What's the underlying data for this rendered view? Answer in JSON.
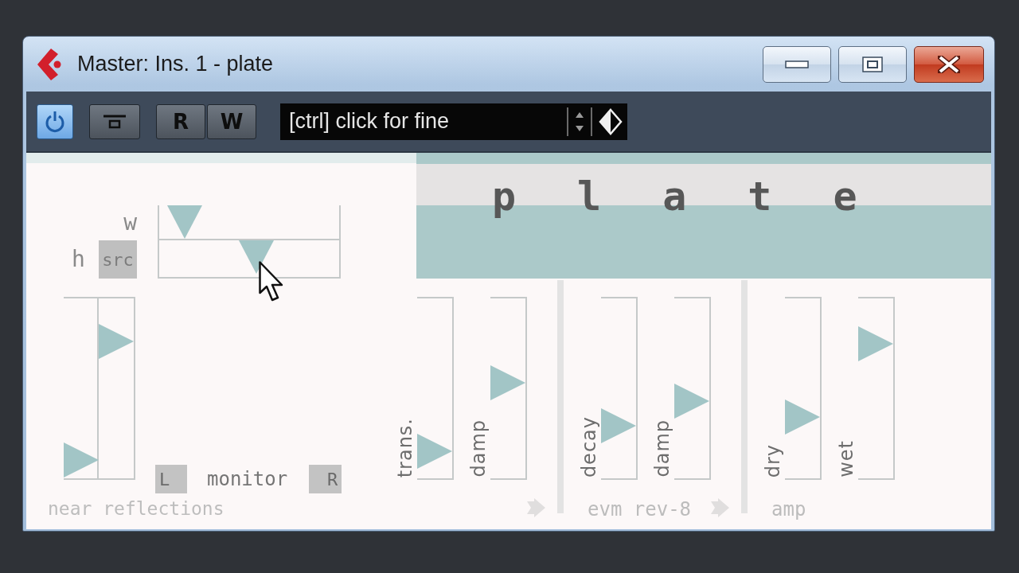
{
  "window": {
    "title": "Master: Ins. 1 - plate"
  },
  "toolbar": {
    "buttons": [
      {
        "kind": "power",
        "on": true
      },
      {
        "kind": "bar",
        "on": false
      },
      {
        "kind": "text",
        "label": "R",
        "on": false
      },
      {
        "kind": "text",
        "label": "W",
        "on": false
      }
    ],
    "display": {
      "text": "[ctrl] click for fine"
    }
  },
  "plugin": {
    "name": "plate",
    "near_reflections": {
      "pad": [
        {
          "label": "w",
          "level": 0.14
        },
        {
          "label": "h",
          "button": "src",
          "level": 0.54
        }
      ],
      "sliders": [
        {
          "level": 0.1
        },
        {
          "level": 0.76
        }
      ],
      "monitor": {
        "left": "L",
        "label": "monitor",
        "right": "R"
      },
      "label": "near reflections"
    },
    "chain": [
      {
        "sliders": [
          {
            "label": "trans.",
            "level": 0.15
          },
          {
            "label": "damp",
            "level": 0.53
          }
        ]
      },
      {
        "label": "evm rev-8",
        "sliders": [
          {
            "label": "decay",
            "level": 0.29
          },
          {
            "label": "damp",
            "level": 0.43
          }
        ]
      },
      {
        "label": "amp",
        "sliders": [
          {
            "label": "dry",
            "level": 0.34
          },
          {
            "label": "wet",
            "level": 0.75
          }
        ]
      }
    ]
  }
}
